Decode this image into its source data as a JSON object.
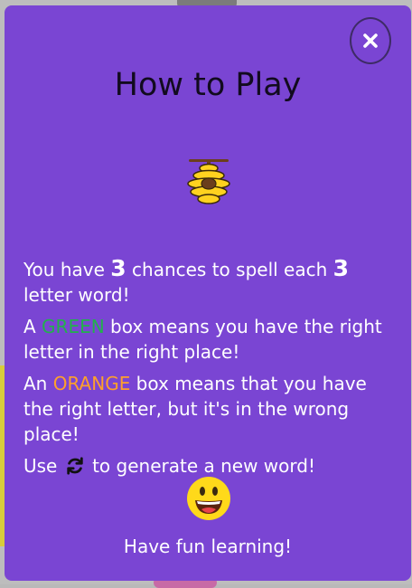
{
  "modal": {
    "close_icon": "close-icon",
    "title": "How to Play",
    "hero_icon": "beehive-icon",
    "lines": {
      "chances_a": "You have ",
      "chances_num1": "3",
      "chances_b": " chances to spell each ",
      "chances_num2": "3",
      "chances_c": " letter word!",
      "green_a": "A ",
      "green_word": "GREEN",
      "green_b": " box means you have the right letter in the right place!",
      "orange_a": "An ",
      "orange_word": "ORANGE",
      "orange_b": " box means that you have the right letter, but it's in the wrong place!",
      "use_a": "Use ",
      "use_icon": "refresh-icon",
      "use_b": " to generate a new word!"
    },
    "smiley_icon": "smiley-icon",
    "footer": "Have fun learning!"
  },
  "colors": {
    "modal_bg": "#7a45d3",
    "green_highlight": "#22b14c",
    "orange_highlight": "#ffa02b",
    "title_color": "#120b1f"
  }
}
